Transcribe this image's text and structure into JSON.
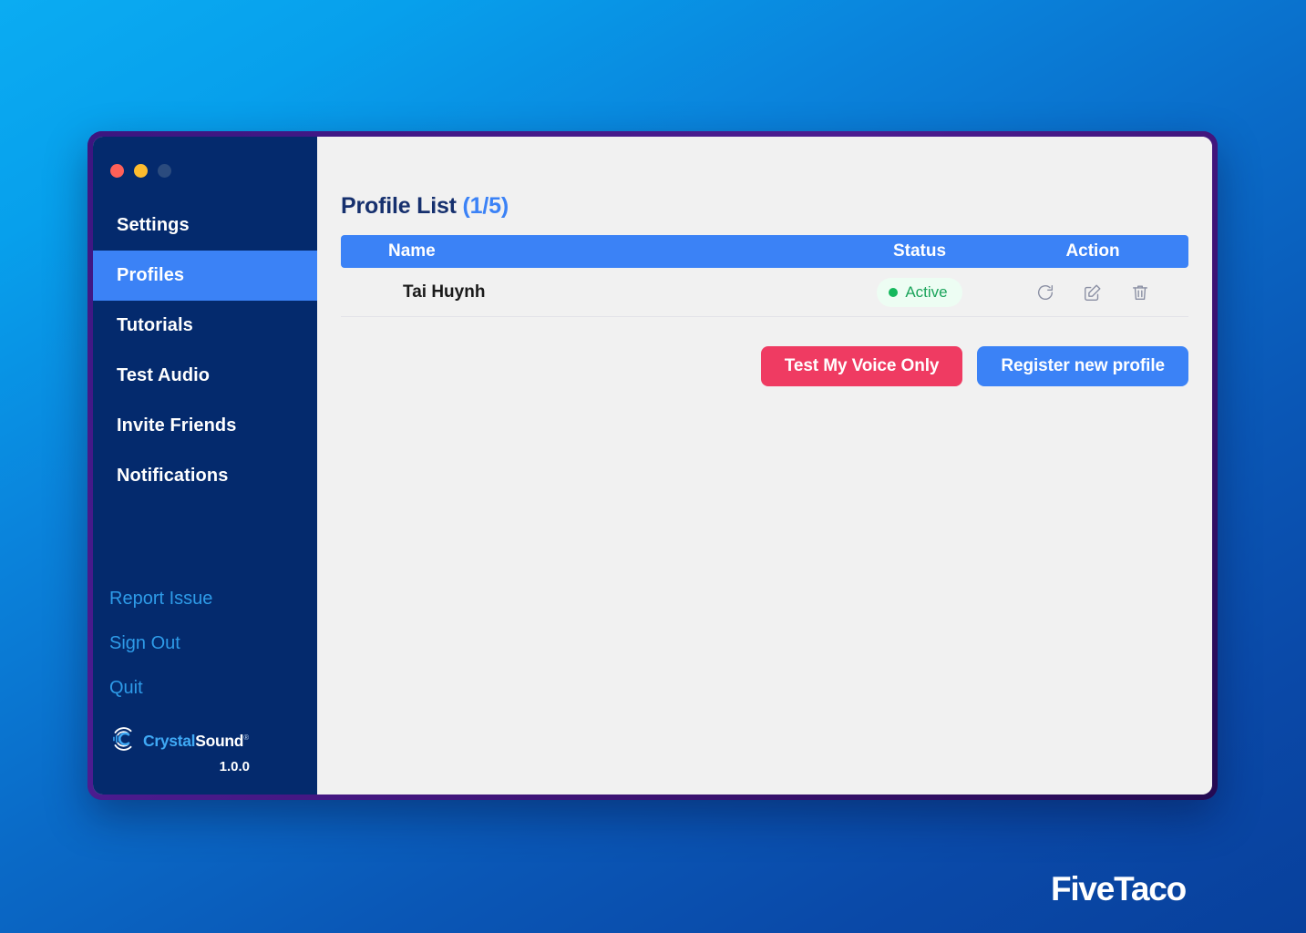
{
  "window": {
    "traffic_lights": [
      {
        "name": "close",
        "color": "#FF6058"
      },
      {
        "name": "minimize",
        "color": "#FEBC2E"
      },
      {
        "name": "maximize",
        "color": "#2B4B7E"
      }
    ]
  },
  "sidebar": {
    "nav_items": [
      {
        "label": "Settings",
        "active": false
      },
      {
        "label": "Profiles",
        "active": true
      },
      {
        "label": "Tutorials",
        "active": false
      },
      {
        "label": "Test Audio",
        "active": false
      },
      {
        "label": "Invite Friends",
        "active": false
      },
      {
        "label": "Notifications",
        "active": false
      }
    ],
    "links": [
      {
        "label": "Report Issue"
      },
      {
        "label": "Sign Out"
      },
      {
        "label": "Quit"
      }
    ],
    "brand": {
      "icon": "soundwave-circle-icon",
      "name_part1": "Crystal",
      "name_part2": "Sound",
      "registered_mark": "®",
      "version": "1.0.0"
    },
    "colors": {
      "background": "#042A6D",
      "active_item": "#3B82F6",
      "link_text": "#2E9BE8"
    }
  },
  "main": {
    "title_text": "Profile List",
    "title_count": "(1/5)",
    "table": {
      "columns": [
        "Name",
        "Status",
        "Action"
      ],
      "rows": [
        {
          "name": "Tai Huynh",
          "status": "Active",
          "actions": [
            "refresh-icon",
            "edit-icon",
            "delete-icon"
          ]
        }
      ]
    },
    "buttons": [
      {
        "label": "Test My Voice Only",
        "color": "#EF3B62"
      },
      {
        "label": "Register new profile",
        "color": "#3B82F6"
      }
    ]
  },
  "watermark": {
    "text": "FiveTaco"
  }
}
